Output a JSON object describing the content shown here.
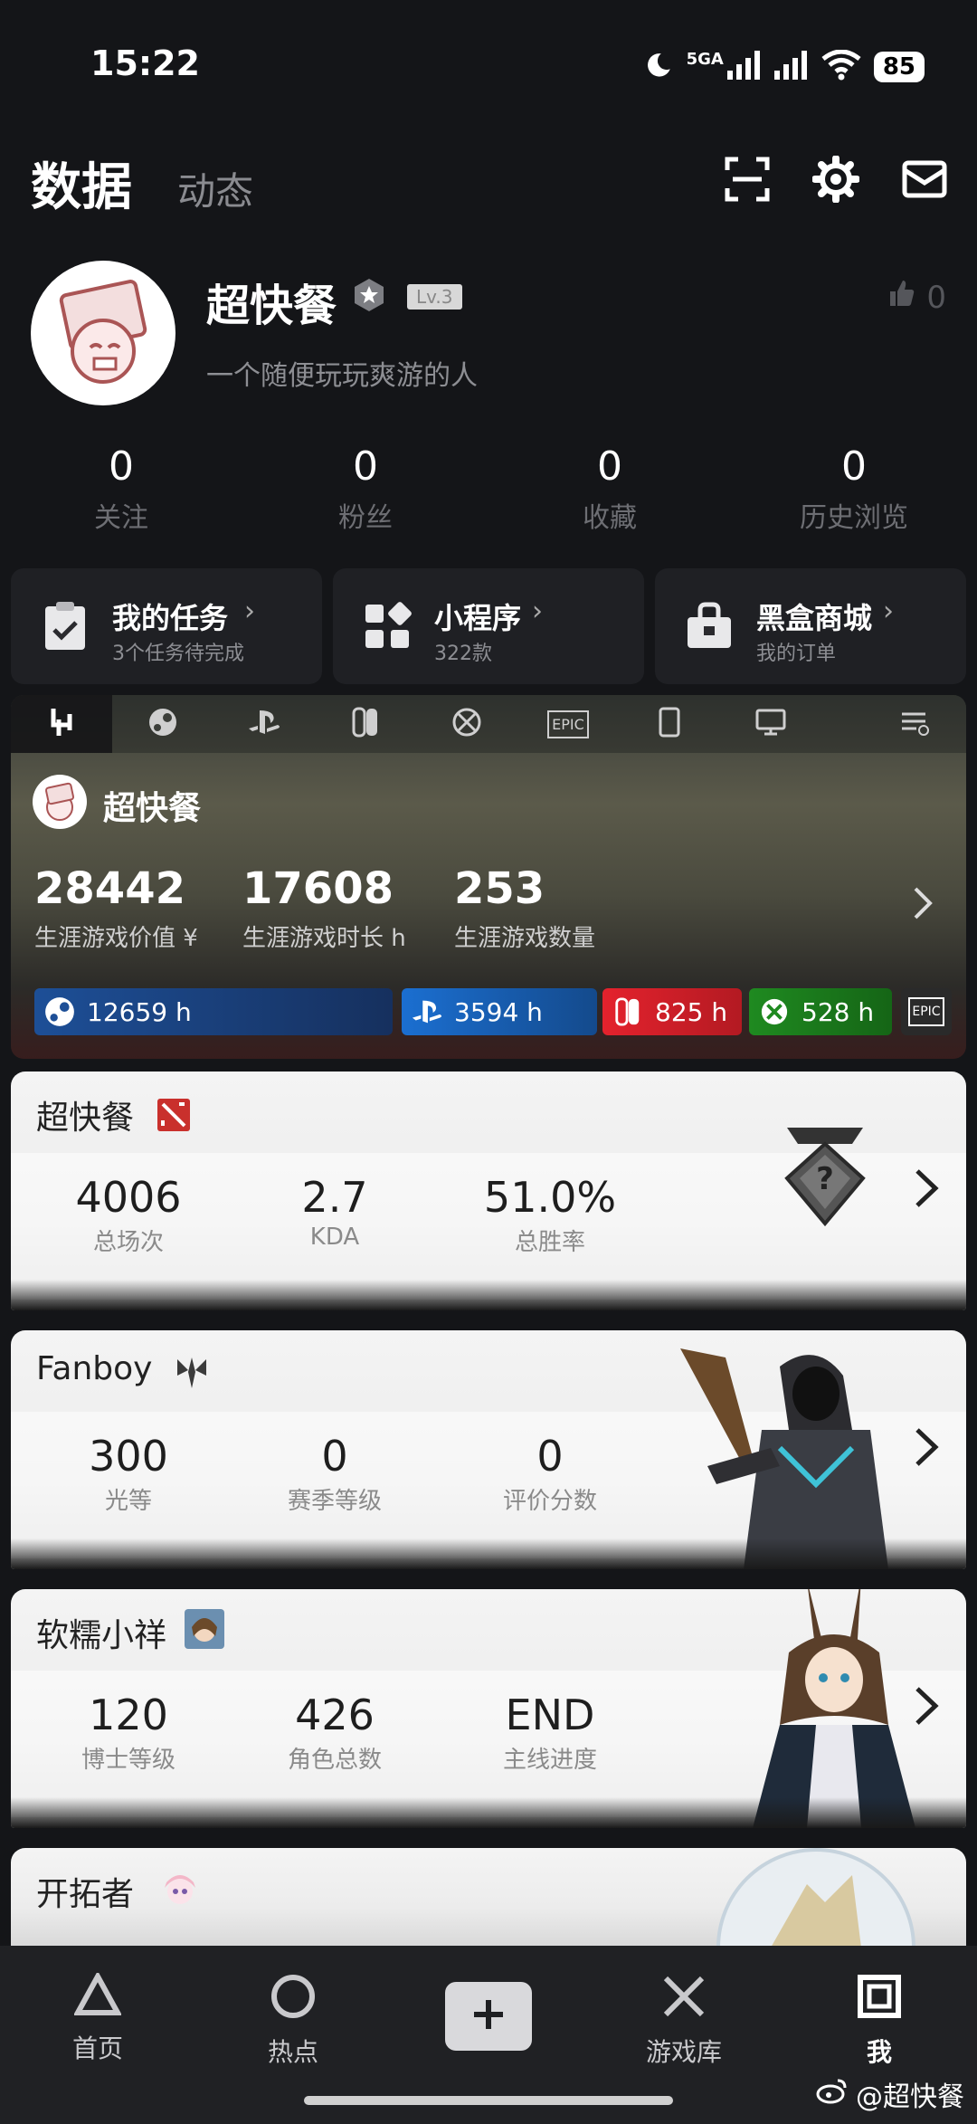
{
  "status_bar": {
    "time": "15:22",
    "network": "5GA",
    "battery": "85"
  },
  "header": {
    "tab_active": "数据",
    "tab_other": "动态"
  },
  "profile": {
    "name": "超快餐",
    "level": "Lv.3",
    "likes": "0",
    "bio": "一个随便玩玩爽游的人",
    "stats": [
      {
        "value": "0",
        "label": "关注"
      },
      {
        "value": "0",
        "label": "粉丝"
      },
      {
        "value": "0",
        "label": "收藏"
      },
      {
        "value": "0",
        "label": "历史浏览"
      }
    ]
  },
  "entries": [
    {
      "title": "我的任务",
      "subtitle": "3个任务待完成"
    },
    {
      "title": "小程序",
      "subtitle": "322款"
    },
    {
      "title": "黑盒商城",
      "subtitle": "我的订单"
    }
  ],
  "platform": {
    "user": "超快餐",
    "value": "28442",
    "value_label": "生涯游戏价值 ¥",
    "hours": "17608",
    "hours_label": "生涯游戏时长 h",
    "games": "253",
    "games_label": "生涯游戏数量",
    "steam": "12659 h",
    "psn": "3594 h",
    "switch": "825 h",
    "xbox": "528 h",
    "epic_label": "EPIC",
    "colors": {
      "steam": "#1e4a8c",
      "psn": "#1b6fd1",
      "switch": "#e4222d",
      "xbox": "#1f8a20"
    }
  },
  "games": [
    {
      "title": "超快餐",
      "stats": [
        {
          "value": "4006",
          "label": "总场次"
        },
        {
          "value": "2.7",
          "label": "KDA"
        },
        {
          "value": "51.0%",
          "label": "总胜率"
        }
      ]
    },
    {
      "title": "Fanboy",
      "stats": [
        {
          "value": "300",
          "label": "光等"
        },
        {
          "value": "0",
          "label": "赛季等级"
        },
        {
          "value": "0",
          "label": "评价分数"
        }
      ]
    },
    {
      "title": "软糯小祥",
      "stats": [
        {
          "value": "120",
          "label": "博士等级"
        },
        {
          "value": "426",
          "label": "角色总数"
        },
        {
          "value": "END",
          "label": "主线进度"
        }
      ]
    },
    {
      "title": "开拓者"
    }
  ],
  "nav": {
    "home": "首页",
    "hot": "热点",
    "library": "游戏库",
    "me": "我"
  },
  "watermark": "@超快餐"
}
